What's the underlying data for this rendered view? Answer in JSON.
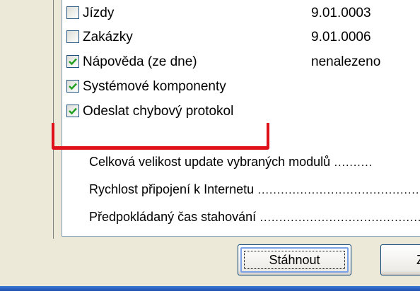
{
  "modules": [
    {
      "label": "Jízdy",
      "version": "9.01.0003",
      "checked": false
    },
    {
      "label": "Zakázky",
      "version": "9.01.0006",
      "checked": false
    },
    {
      "label": "Nápověda (ze dne)",
      "version": "nenalezeno",
      "checked": true
    },
    {
      "label": "Systémové komponenty",
      "version": "",
      "checked": true
    },
    {
      "label": "Odeslat chybový protokol",
      "version": "",
      "checked": true
    }
  ],
  "info": [
    {
      "label": "Celková velikost update vybraných modulů",
      "dots": " .........."
    },
    {
      "label": "Rychlost připojení k Internetu",
      "dots": " ............................................."
    },
    {
      "label": "Předpokládaný čas stahování",
      "dots": " ................................................"
    }
  ],
  "buttons": {
    "download_label": "Stáhnout",
    "other_label": "Z"
  },
  "colors": {
    "highlight": "#e0101a",
    "checkmark": "#21a121",
    "checkbox_border": "#1c5180"
  }
}
